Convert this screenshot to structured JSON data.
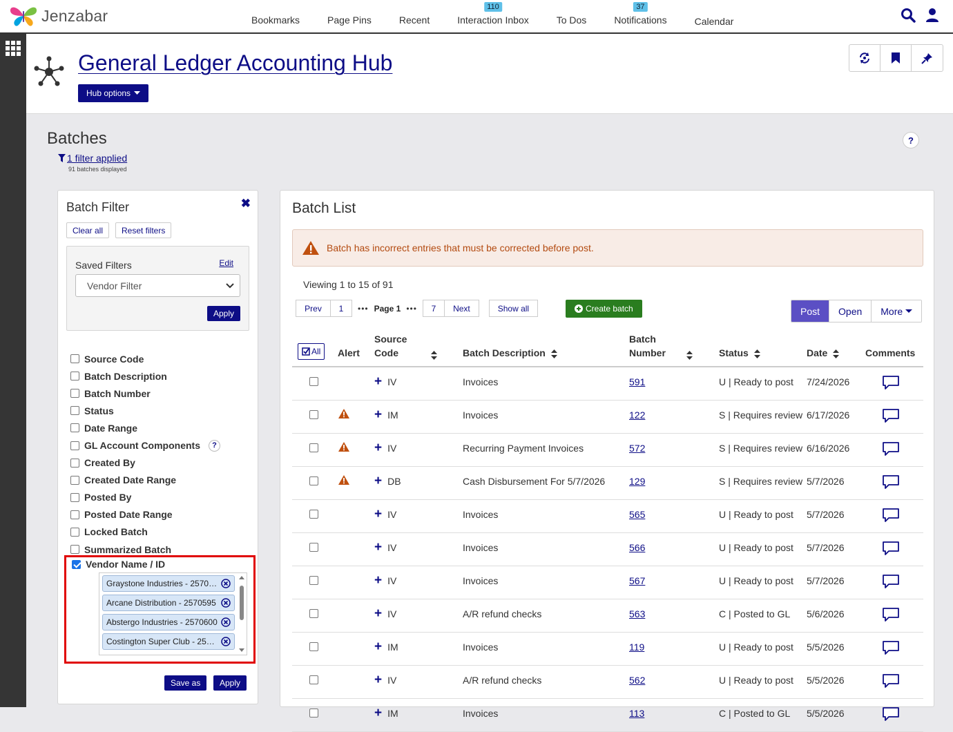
{
  "topbar": {
    "logo_text": "Jenzabar",
    "nav": [
      {
        "label": "Bookmarks",
        "badge": ""
      },
      {
        "label": "Page Pins",
        "badge": ""
      },
      {
        "label": "Recent",
        "badge": ""
      },
      {
        "label": "Interaction Inbox",
        "badge": "110"
      },
      {
        "label": "To Dos",
        "badge": ""
      },
      {
        "label": "Notifications",
        "badge": "37"
      },
      {
        "label": "Calendar",
        "badge": ""
      }
    ]
  },
  "hub": {
    "title": "General Ledger Accounting Hub",
    "options_label": "Hub options"
  },
  "batches": {
    "title": "Batches",
    "filter_link": "1 filter applied",
    "count": "91 batches displayed",
    "help": "?"
  },
  "filter_panel": {
    "title": "Batch Filter",
    "close": "✖",
    "clear_all": "Clear all",
    "reset_filters": "Reset filters",
    "saved_label": "Saved Filters",
    "edit_label": "Edit",
    "selected_filter": "Vendor Filter",
    "apply_label": "Apply",
    "filters": [
      {
        "label": "Source Code",
        "checked": false
      },
      {
        "label": "Batch Description",
        "checked": false
      },
      {
        "label": "Batch Number",
        "checked": false
      },
      {
        "label": "Status",
        "checked": false
      },
      {
        "label": "Date Range",
        "checked": false
      },
      {
        "label": "GL Account Components",
        "checked": false,
        "help": "?"
      },
      {
        "label": "Created By",
        "checked": false
      },
      {
        "label": "Created Date Range",
        "checked": false
      },
      {
        "label": "Posted By",
        "checked": false
      },
      {
        "label": "Posted Date Range",
        "checked": false
      },
      {
        "label": "Locked Batch",
        "checked": false
      },
      {
        "label": "Summarized Batch",
        "checked": false
      }
    ],
    "vendor": {
      "label": "Vendor Name / ID",
      "checked": true,
      "tags": [
        "Graystone Industries - 2570…",
        "Arcane Distribution - 2570595",
        "Abstergo Industries - 2570600",
        "Costington Super Club - 257…"
      ]
    },
    "save_as_label": "Save as",
    "bottom_apply_label": "Apply"
  },
  "batch_list": {
    "title": "Batch List",
    "alert_text": "Batch has incorrect entries that must be corrected before post.",
    "viewing": "Viewing 1 to 15 of 91",
    "pager": {
      "prev": "Prev",
      "first": "1",
      "dots": "•••",
      "current": "Page 1",
      "last": "7",
      "next": "Next"
    },
    "show_all": "Show all",
    "create_batch": "Create batch",
    "views": [
      "Post",
      "Open",
      "More"
    ],
    "active_view": "Post",
    "columns": {
      "all": "All",
      "alert": "Alert",
      "source_code": "Source Code",
      "description": "Batch Description",
      "batch_number": "Batch Number",
      "status": "Status",
      "date": "Date",
      "comments": "Comments"
    },
    "rows": [
      {
        "alert": false,
        "code": "IV",
        "description": "Invoices",
        "number": "591",
        "status": "U | Ready to post",
        "date": "7/24/2026"
      },
      {
        "alert": true,
        "code": "IM",
        "description": "Invoices",
        "number": "122",
        "status": "S | Requires review",
        "date": "6/17/2026"
      },
      {
        "alert": true,
        "code": "IV",
        "description": "Recurring Payment Invoices",
        "number": "572",
        "status": "S | Requires review",
        "date": "6/16/2026"
      },
      {
        "alert": true,
        "code": "DB",
        "description": "Cash Disbursement For 5/7/2026",
        "number": "129",
        "status": "S | Requires review",
        "date": "5/7/2026"
      },
      {
        "alert": false,
        "code": "IV",
        "description": "Invoices",
        "number": "565",
        "status": "U | Ready to post",
        "date": "5/7/2026"
      },
      {
        "alert": false,
        "code": "IV",
        "description": "Invoices",
        "number": "566",
        "status": "U | Ready to post",
        "date": "5/7/2026"
      },
      {
        "alert": false,
        "code": "IV",
        "description": "Invoices",
        "number": "567",
        "status": "U | Ready to post",
        "date": "5/7/2026"
      },
      {
        "alert": false,
        "code": "IV",
        "description": "A/R refund checks",
        "number": "563",
        "status": "C | Posted to GL",
        "date": "5/6/2026"
      },
      {
        "alert": false,
        "code": "IM",
        "description": "Invoices",
        "number": "119",
        "status": "U | Ready to post",
        "date": "5/5/2026"
      },
      {
        "alert": false,
        "code": "IV",
        "description": "A/R refund checks",
        "number": "562",
        "status": "U | Ready to post",
        "date": "5/5/2026"
      },
      {
        "alert": false,
        "code": "IM",
        "description": "Invoices",
        "number": "113",
        "status": "C | Posted to GL",
        "date": "5/5/2026"
      }
    ]
  },
  "colors": {
    "brand_navy": "#0d0d86",
    "create_green": "#2a7d1f",
    "active_purple": "#5b4fc4",
    "alert_orange": "#c0500f",
    "highlight_red": "#e00000"
  }
}
